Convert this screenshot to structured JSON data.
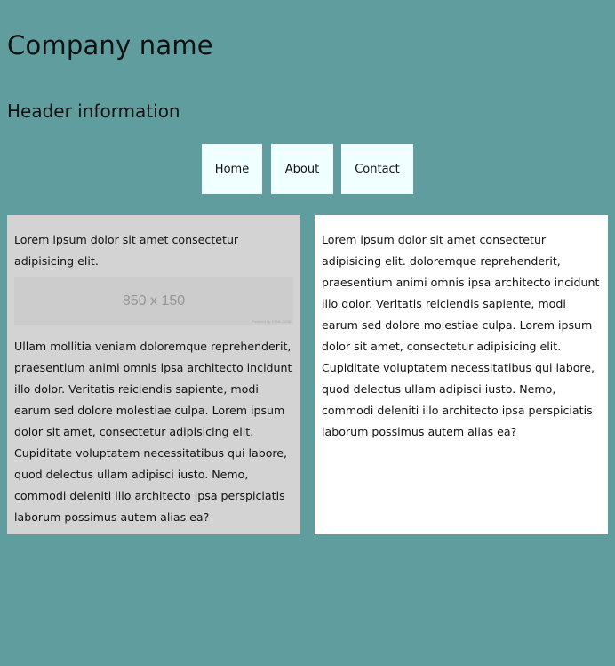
{
  "header": {
    "company_name": "Company name",
    "header_info": "Header information"
  },
  "nav": {
    "items": [
      {
        "label": "Home"
      },
      {
        "label": "About"
      },
      {
        "label": "Contact"
      }
    ]
  },
  "columns": {
    "left": {
      "intro": "Lorem ipsum dolor sit amet consectetur adipisicing elit.",
      "image": {
        "label": "850 x 150",
        "credit": "Powered by HTML.COM"
      },
      "body": "Ullam mollitia veniam doloremque reprehenderit, praesentium animi omnis ipsa architecto incidunt illo dolor. Veritatis reiciendis sapiente, modi earum sed dolore molestiae culpa. Lorem ipsum dolor sit amet, consectetur adipisicing elit. Cupiditate voluptatem necessitatibus qui labore, quod delectus ullam adipisci iusto. Nemo, commodi deleniti illo architecto ipsa perspiciatis laborum possimus autem alias ea?"
    },
    "right": {
      "body": "Lorem ipsum dolor sit amet consectetur adipisicing elit. doloremque reprehenderit, praesentium animi omnis ipsa architecto incidunt illo dolor. Veritatis reiciendis sapiente, modi earum sed dolore molestiae culpa. Lorem ipsum dolor sit amet, consectetur adipisicing elit. Cupiditate voluptatem necessitatibus qui labore, quod delectus ullam adipisci iusto. Nemo, commodi deleniti illo architecto ipsa perspiciatis laborum possimus autem alias ea?"
    }
  },
  "colors": {
    "page_background": "#609d9f",
    "nav_item_background": "#f0ffff",
    "left_column_background": "#d3d3d3",
    "right_column_background": "#ffffff",
    "placeholder_background": "#cccccc"
  }
}
